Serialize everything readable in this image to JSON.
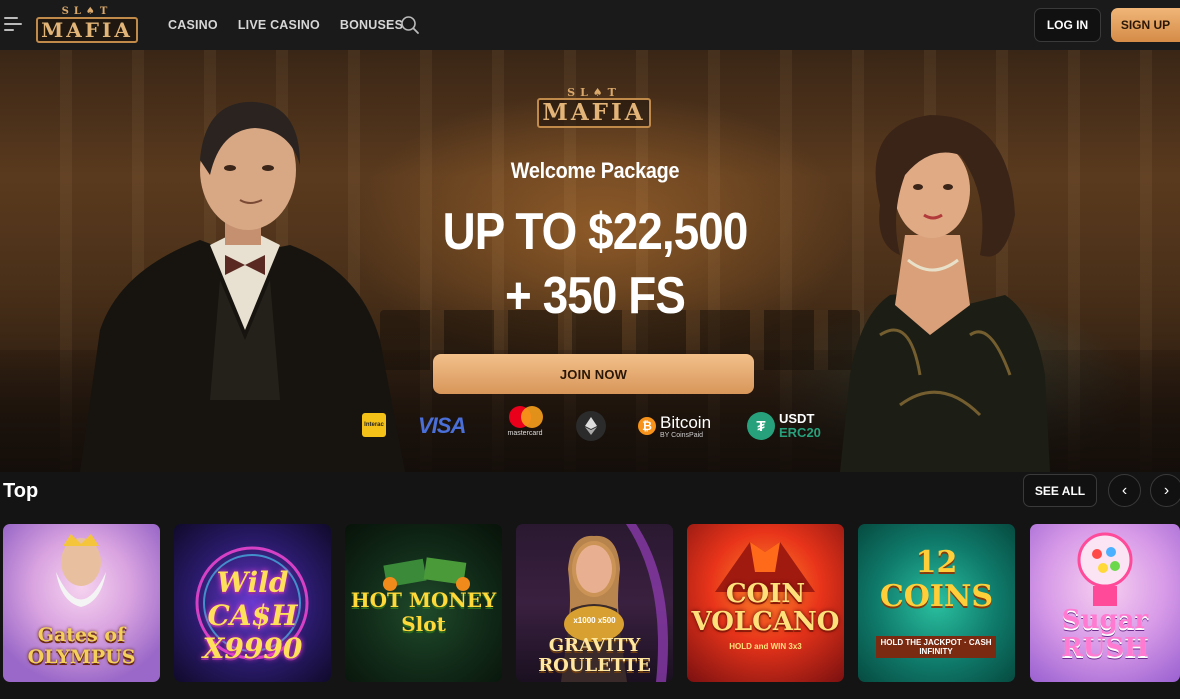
{
  "header": {
    "logo_top": "SL♠T",
    "logo_main": "MAFIA",
    "nav": [
      "CASINO",
      "LIVE CASINO",
      "BONUSES"
    ],
    "login_label": "LOG IN",
    "signup_label": "SIGN UP"
  },
  "hero": {
    "logo_top": "SL♠T",
    "logo_main": "MAFIA",
    "welcome": "Welcome Package",
    "headline_line1": "UP TO $22,500",
    "headline_line2": "+ 350 FS",
    "cta_label": "JOIN NOW",
    "payments": {
      "interac": "Interac",
      "visa": "VISA",
      "mastercard": "mastercard",
      "bitcoin": "Bitcoin",
      "bitcoin_sub": "BY CoinsPaid",
      "usdt": "USDT",
      "usdt_network": "ERC20"
    }
  },
  "top_section": {
    "title": "Top",
    "see_all_label": "SEE ALL",
    "prev_arrow": "‹",
    "next_arrow": "›",
    "games": [
      {
        "title": "Gates of OLYMPUS"
      },
      {
        "title": "Wild CA$H X9990"
      },
      {
        "title": "HOT MONEY Slot"
      },
      {
        "title": "GRAVITY ROULETTE",
        "sub": "x1000 x500"
      },
      {
        "title": "COIN VOLCANO",
        "sub": "HOLD and WIN 3x3"
      },
      {
        "title": "12 COINS",
        "sub": "HOLD THE JACKPOT · CASH INFINITY"
      },
      {
        "title": "Sugar RUSH"
      }
    ]
  },
  "colors": {
    "accent": "#d89a5c",
    "background": "#141414",
    "header_bg": "#1a1a1a"
  }
}
